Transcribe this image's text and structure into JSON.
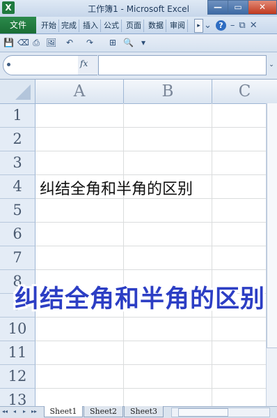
{
  "window": {
    "title": "工作簿1 - Microsoft Excel",
    "app_icon": "excel-icon",
    "controls": [
      "—",
      "▭",
      "✕"
    ]
  },
  "ribbon": {
    "file_tab": "文件",
    "tabs": [
      "开始",
      "完成",
      "插入",
      "公式",
      "页面",
      "数据",
      "审阅"
    ],
    "scroll_glyph": "▸",
    "icons": [
      "minimize-ribbon-icon",
      "help-icon",
      "window-minimize-icon",
      "window-restore-icon",
      "window-close-icon"
    ],
    "icon_glyphs": [
      "⌄",
      "?",
      "–",
      "⧉",
      "✕"
    ]
  },
  "quick_access": {
    "icons": [
      "save-icon",
      "eraser-icon",
      "print-icon",
      "picture-icon",
      "undo-icon",
      "redo-icon",
      "borders-icon",
      "print-preview-icon",
      "customize-icon"
    ],
    "glyphs": [
      "💾",
      "⌫",
      "⎙",
      "🖼",
      "↶",
      "↷",
      "⊞",
      "🔍",
      "▾"
    ]
  },
  "formula_bar": {
    "name_box_value": "",
    "fx_label": "fx",
    "formula_value": "",
    "expand_glyph": "⌄"
  },
  "sheet": {
    "columns": [
      "A",
      "B",
      "C"
    ],
    "rows": [
      "1",
      "2",
      "3",
      "4",
      "5",
      "6",
      "7",
      "8",
      "9",
      "10",
      "11",
      "12",
      "13"
    ],
    "cell_a4": "纠结全角和半角的区别"
  },
  "overlay_caption": "纠结全角和半角的区别",
  "sheet_tabs": {
    "nav_glyphs": [
      "◂◂",
      "◂",
      "▸",
      "▸▸"
    ],
    "tabs": [
      "Sheet1",
      "Sheet2",
      "Sheet3"
    ],
    "active_index": 0
  },
  "colors": {
    "file_tab": "#1e7b3f",
    "caption": "#2c3ec4",
    "header_bg": "#dbe5f1"
  }
}
